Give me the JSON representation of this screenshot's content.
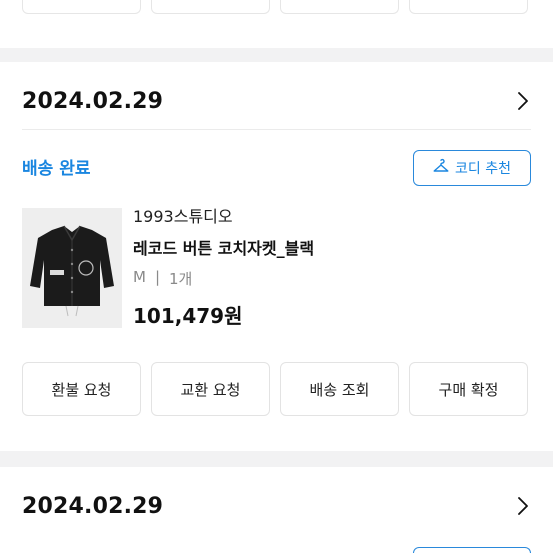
{
  "orders": [
    {
      "date": "2024.02.29",
      "status": "배송 완료",
      "codi_button_label": "코디 추천",
      "product": {
        "brand": "1993스튜디오",
        "name": "레코드 버튼 코치자켓_블랙",
        "option_size": "M",
        "option_separator": "|",
        "option_qty": "1개",
        "price": "101,479원"
      },
      "actions": [
        "환불 요청",
        "교환 요청",
        "배송 조회",
        "구매 확정"
      ]
    },
    {
      "date": "2024.02.29"
    }
  ],
  "colors": {
    "accent": "#1a86e0",
    "section_gap": "#f2f2f3",
    "border": "#e3e3e3",
    "muted_text": "#8a8a8a"
  },
  "icons": {
    "order_detail": "chevron-right-icon",
    "codi": "hanger-icon"
  }
}
